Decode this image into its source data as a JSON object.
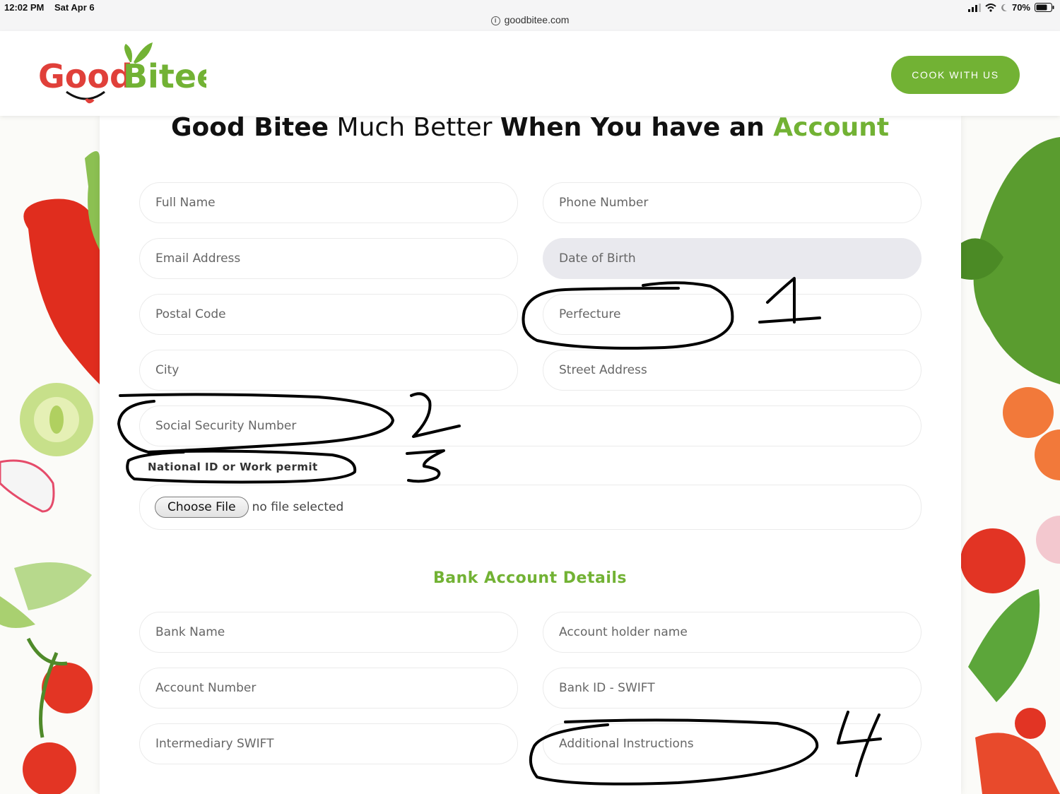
{
  "status_bar": {
    "time": "12:02 PM",
    "date": "Sat Apr 6",
    "battery": "70%"
  },
  "browser": {
    "url": "goodbitee.com"
  },
  "header": {
    "logo_text_good": "Good",
    "logo_text_bitee": "Bitee",
    "cta_label": "COOK WITH US"
  },
  "headline": {
    "part1": "Good Bitee",
    "part2": " Much Better ",
    "part3": "When You have an ",
    "part4": "Account"
  },
  "form": {
    "full_name": "Full Name",
    "phone_number": "Phone Number",
    "email_address": "Email Address",
    "date_of_birth": "Date of Birth",
    "postal_code": "Postal Code",
    "perfecture": "Perfecture",
    "city": "City",
    "street_address": "Street Address",
    "ssn": "Social Security Number",
    "file_label": "National ID or Work permit",
    "choose_file": "Choose File",
    "file_status": "no file selected"
  },
  "bank": {
    "title": "Bank Account Details",
    "bank_name": "Bank Name",
    "account_holder": "Account holder name",
    "account_number": "Account Number",
    "bank_id_swift": "Bank ID - SWIFT",
    "intermediary_swift": "Intermediary SWIFT",
    "additional_instructions": "Additional Instructions"
  },
  "annotations": {
    "n1": "1",
    "n2": "2",
    "n3": "3",
    "n4": "4"
  },
  "colors": {
    "brand_green": "#72b234",
    "logo_red": "#e0403a"
  }
}
